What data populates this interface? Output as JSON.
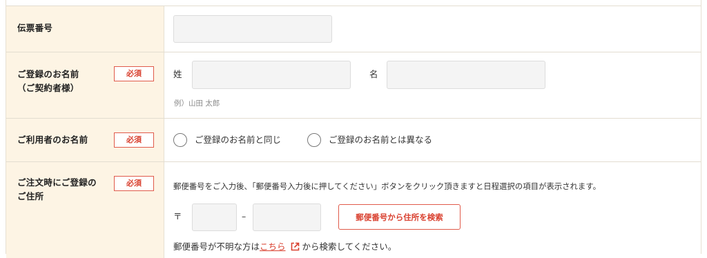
{
  "rows": {
    "slip_number": {
      "label": "伝票番号",
      "value": ""
    },
    "registered_name": {
      "label_line1": "ご登録のお名前",
      "label_line2": "（ご契約者様）",
      "badge": "必須",
      "last_name_label": "姓",
      "last_name_value": "",
      "first_name_label": "名",
      "first_name_value": "",
      "example": "例）山田 太郎"
    },
    "user_name": {
      "label": "ご利用者のお名前",
      "badge": "必須",
      "options": [
        {
          "label": "ご登録のお名前と同じ",
          "selected": false
        },
        {
          "label": "ご登録のお名前とは異なる",
          "selected": false
        }
      ]
    },
    "address": {
      "label_line1": "ご注文時にご登録の",
      "label_line2": "ご住所",
      "badge": "必須",
      "instruction": "郵便番号をご入力後、「郵便番号入力後に押してください」ボタンをクリック頂きますと日程選択の項目が表示されます。",
      "postal_mark": "〒",
      "postal_separator": "–",
      "postal_part1": "",
      "postal_part2": "",
      "search_button": "郵便番号から住所を検索",
      "note_prefix": "郵便番号が不明な方は",
      "note_link": "こちら",
      "note_suffix": " から検索してください。"
    }
  },
  "colors": {
    "accent": "#d9402f",
    "label_bg": "#fdf4e4",
    "input_bg": "#f4f4f4"
  },
  "icons": {
    "external_link": "external-link-icon"
  }
}
